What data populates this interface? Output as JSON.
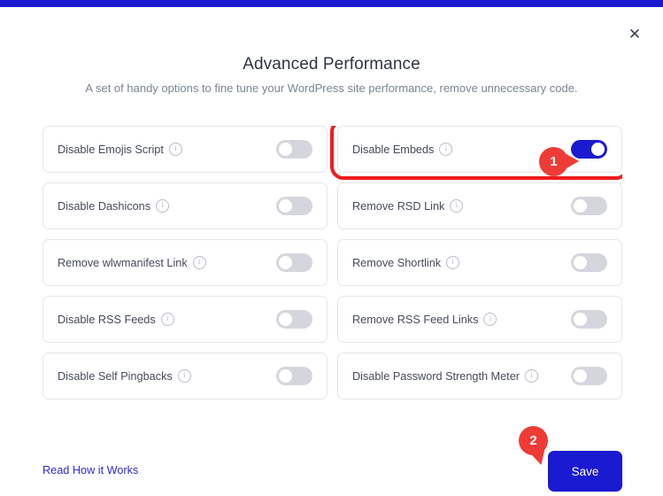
{
  "theme": {
    "accent_blue": "#1a1ad1",
    "callout_red": "#ef3b36",
    "highlight_red": "#f01d1d",
    "toggle_off": "#d5d6dd",
    "link_blue": "#2b2bd8"
  },
  "header": {
    "title": "Advanced Performance",
    "subtitle": "A set of handy options to fine tune your WordPress site performance, remove unnecessary code.",
    "close_icon": "close-icon",
    "close_glyph": "✕"
  },
  "options": {
    "info_glyph": "i",
    "left_column": [
      {
        "label": "Disable Emojis Script",
        "enabled": false,
        "highlighted": false
      },
      {
        "label": "Disable Dashicons",
        "enabled": false,
        "highlighted": false
      },
      {
        "label": "Remove wlwmanifest Link",
        "enabled": false,
        "highlighted": false
      },
      {
        "label": "Disable RSS Feeds",
        "enabled": false,
        "highlighted": false
      },
      {
        "label": "Disable Self Pingbacks",
        "enabled": false,
        "highlighted": false
      },
      {
        "label": "",
        "enabled": false,
        "highlighted": false
      }
    ],
    "right_column": [
      {
        "label": "Disable Embeds",
        "enabled": true,
        "highlighted": true
      },
      {
        "label": "Remove RSD Link",
        "enabled": false,
        "highlighted": false
      },
      {
        "label": "Remove Shortlink",
        "enabled": false,
        "highlighted": false
      },
      {
        "label": "Remove RSS Feed Links",
        "enabled": false,
        "highlighted": false
      },
      {
        "label": "Disable Password Strength Meter",
        "enabled": false,
        "highlighted": false
      }
    ]
  },
  "callouts": [
    {
      "number": "1",
      "target": "disable-embeds-toggle"
    },
    {
      "number": "2",
      "target": "save-button"
    }
  ],
  "footer": {
    "link_label": "Read How it Works",
    "save_label": "Save"
  }
}
